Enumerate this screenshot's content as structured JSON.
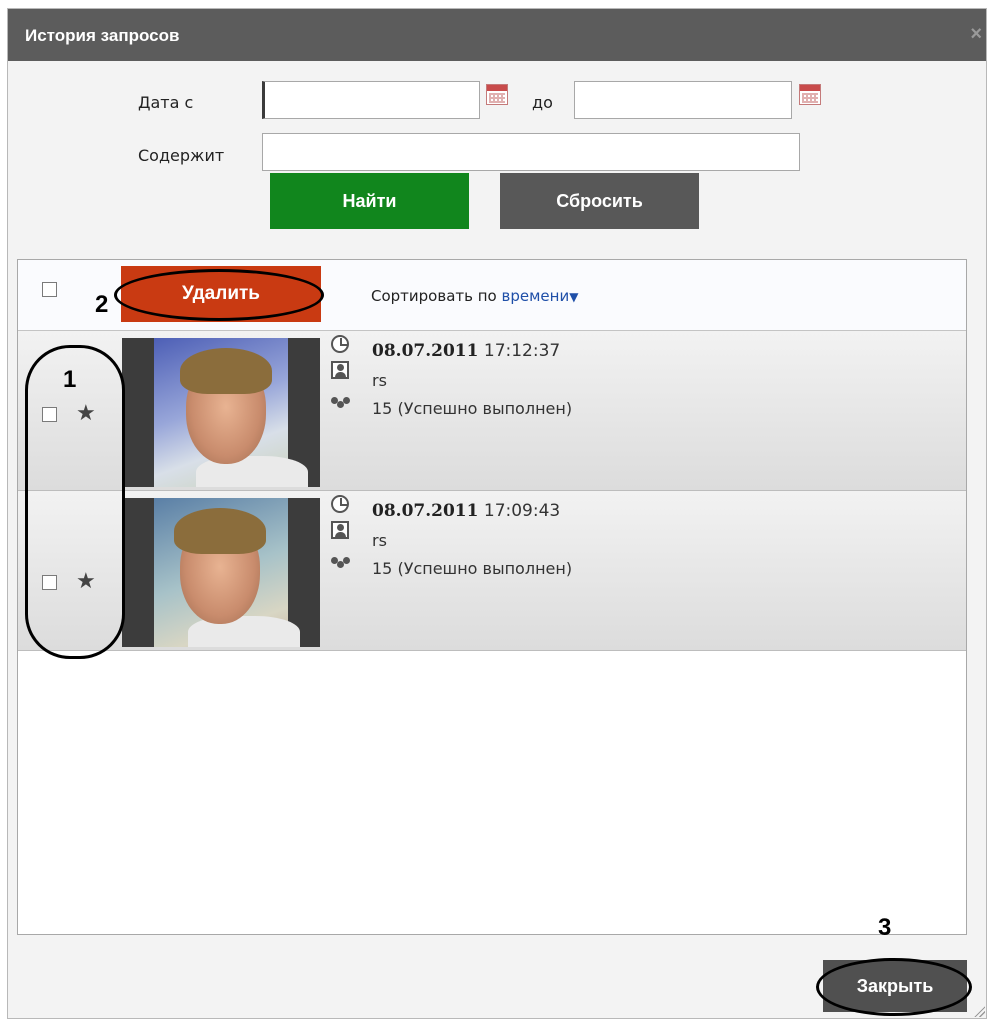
{
  "dialog": {
    "title": "История запросов",
    "close_icon": "close-icon"
  },
  "filter": {
    "date_from_label": "Дата с",
    "date_from_value": "",
    "date_to_label": "до",
    "date_to_value": "",
    "contains_label": "Содержит",
    "contains_value": "",
    "calendar_icon": "calendar-icon",
    "find_label": "Найти",
    "reset_label": "Сбросить"
  },
  "results": {
    "delete_label": "Удалить",
    "sort_prefix": "Сортировать по",
    "sort_field": "времени",
    "sort_arrow": "▼",
    "rows": [
      {
        "date": "08.07.2011",
        "time": "17:12:37",
        "user": "rs",
        "count": "15",
        "status": "(Успешно выполнен)",
        "checked": false,
        "starred": true
      },
      {
        "date": "08.07.2011",
        "time": "17:09:43",
        "user": "rs",
        "count": "15",
        "status": "(Успешно выполнен)",
        "checked": false,
        "starred": true
      }
    ]
  },
  "annotations": {
    "marker_1": "1",
    "marker_2": "2",
    "marker_3": "3"
  },
  "footer": {
    "close_label": "Закрыть"
  },
  "colors": {
    "titlebar": "#5c5c5c",
    "find_button": "#11861d",
    "reset_button": "#585858",
    "delete_button": "#c93a12",
    "close_button": "#505050",
    "sort_link": "#1f4fa8"
  }
}
